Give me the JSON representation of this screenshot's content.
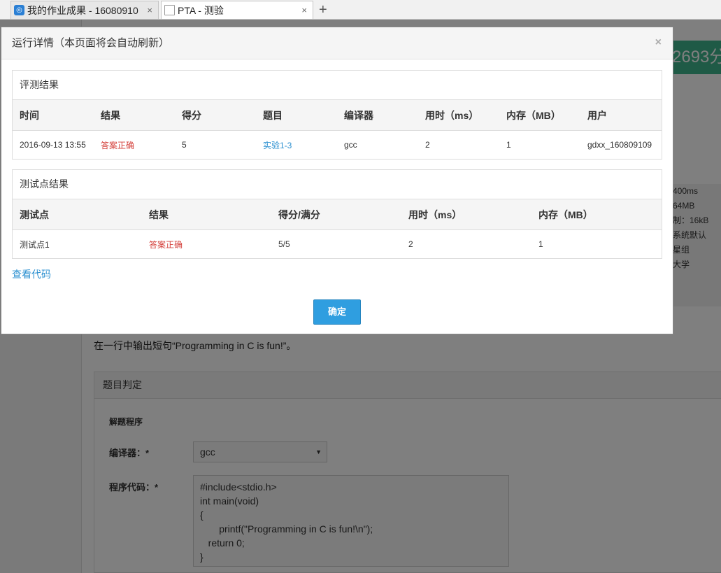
{
  "browser": {
    "tabs": [
      {
        "title": "我的作业成果 - 16080910",
        "close": "×"
      },
      {
        "title": "PTA - 测验",
        "close": "×"
      }
    ],
    "new_tab": "+"
  },
  "page": {
    "score_text": "2693分",
    "info_lines": [
      "400ms",
      "64MB",
      "制：16kB",
      "系统默认",
      "星组",
      "大学"
    ],
    "description": "在一行中输出短句“Programming in C is fun!”。",
    "judge_panel": {
      "title": "题目判定",
      "section": "解题程序",
      "compiler_label": "编译器：*",
      "compiler_value": "gcc",
      "code_label": "程序代码：*",
      "code": "#include<stdio.h>\nint main(void)\n{\n       printf(\"Programming in C is fun!\\n\");\n   return 0;\n}"
    }
  },
  "modal": {
    "title": "运行详情（本页面将会自动刷新）",
    "close": "×",
    "eval": {
      "title": "评测结果",
      "headers": [
        "时间",
        "结果",
        "得分",
        "题目",
        "编译器",
        "用时（ms）",
        "内存（MB）",
        "用户"
      ],
      "row": {
        "time": "2016-09-13 13:55",
        "result": "答案正确",
        "score": "5",
        "problem": "实验1-3",
        "compiler": "gcc",
        "time_ms": "2",
        "memory": "1",
        "user": "gdxx_160809109"
      }
    },
    "testcases": {
      "title": "测试点结果",
      "headers": [
        "测试点",
        "结果",
        "得分/满分",
        "用时（ms）",
        "内存（MB）"
      ],
      "row": {
        "case": "测试点1",
        "result": "答案正确",
        "score": "5/5",
        "time_ms": "2",
        "memory": "1"
      }
    },
    "view_code": "查看代码",
    "confirm": "确定"
  }
}
